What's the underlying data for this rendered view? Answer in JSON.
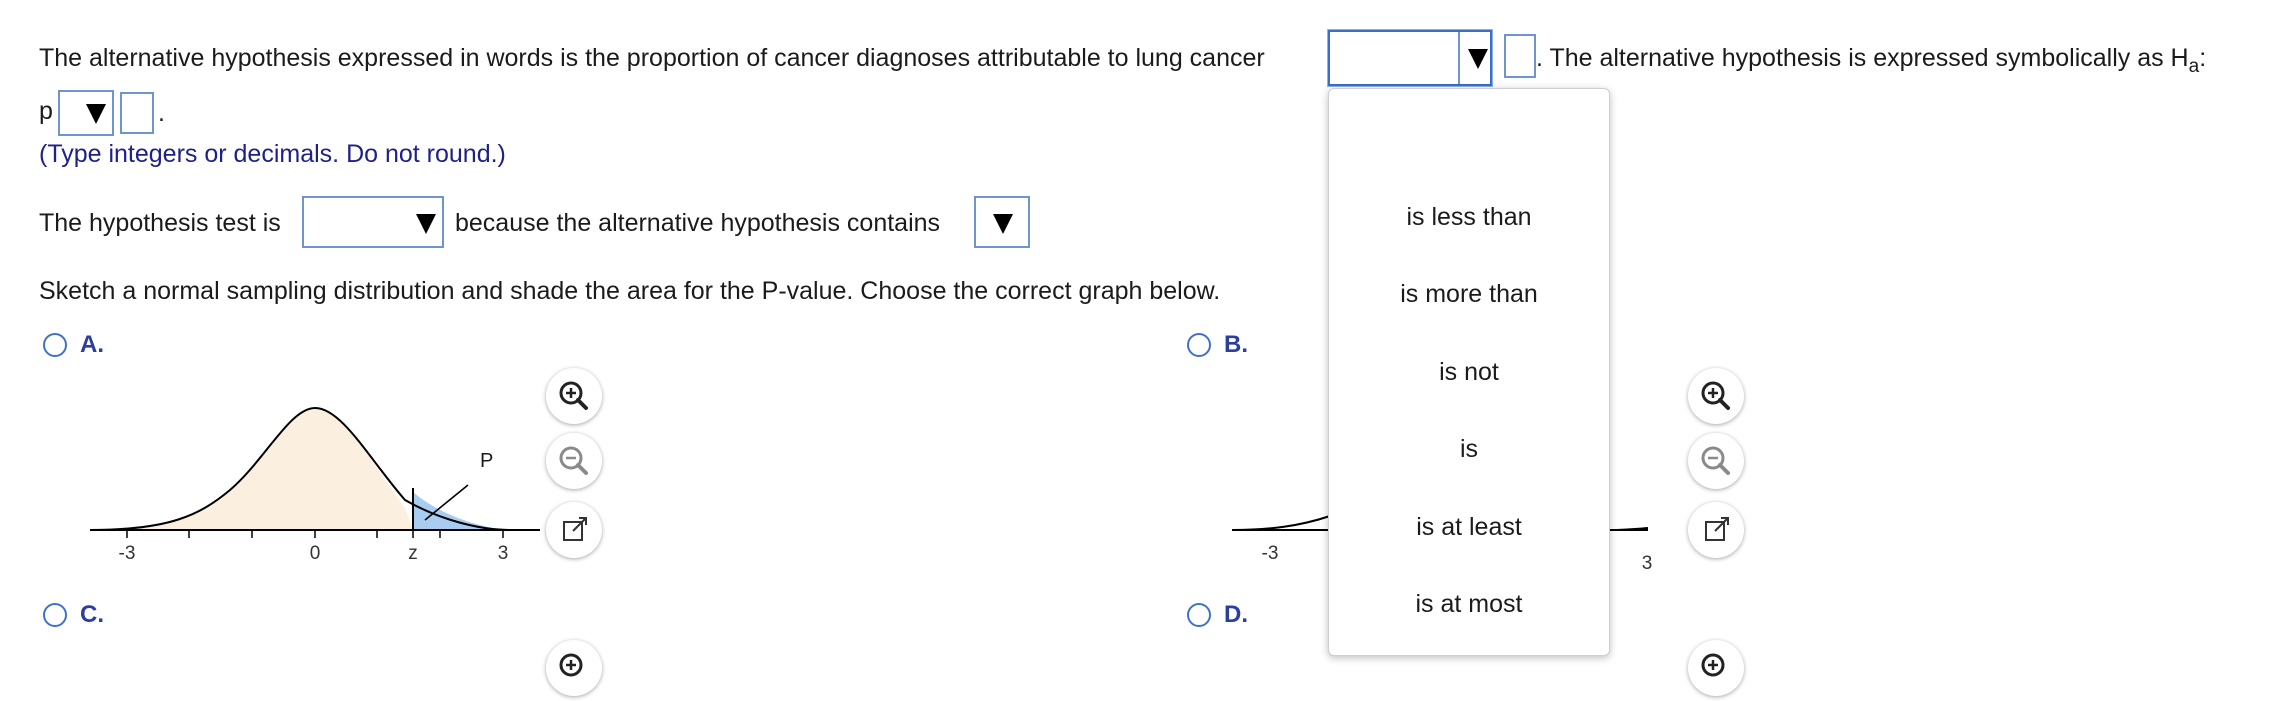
{
  "question": {
    "alt_hypothesis_words": "The alternative hypothesis expressed in words is the proportion of cancer diagnoses attributable to lung cancer",
    "alt_hypothesis_symbolic_prefix": ". The alternative hypothesis is expressed symbolically as H",
    "alt_hypothesis_subscript": "a",
    "alt_hypothesis_colon": ":",
    "p_label": "p",
    "period": ".",
    "note": "(Type integers or decimals. Do not round.)",
    "test_prefix": "The hypothesis test is",
    "test_middle": "because the alternative hypothesis contains",
    "sketch_instruction": "Sketch a normal sampling distribution and shade the area for the P-value. Choose the correct graph below."
  },
  "options": {
    "a": "A.",
    "b": "B.",
    "c": "C.",
    "d": "D."
  },
  "graph_a": {
    "tick_labels": [
      "-3",
      "0",
      "z",
      "3"
    ],
    "p_label": "P",
    "body_color": "#fbf0e0",
    "tail_color": "#a9cdf0"
  },
  "graph_b": {
    "tick_labels": [
      "-3",
      "3"
    ]
  },
  "dropdown_menu": {
    "items": [
      "is less than",
      "is more than",
      "is not",
      "is",
      "is at least",
      "is at most"
    ]
  },
  "icons": {
    "zoom_in": "zoom-in-icon",
    "zoom_out": "zoom-out-icon",
    "popout": "popout-icon",
    "dropdown_arrow": "triangle-down-icon"
  },
  "colors": {
    "accent": "#3f72c6",
    "option_label": "#2c3f9f",
    "note": "#20208a"
  }
}
